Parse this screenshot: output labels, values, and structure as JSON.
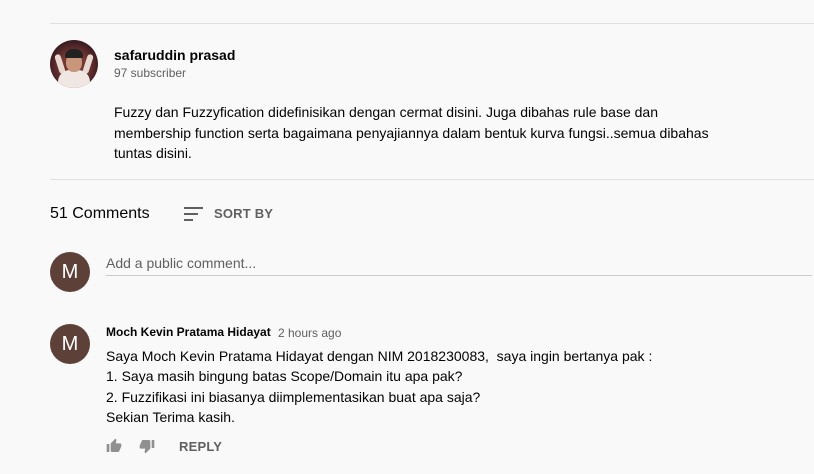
{
  "channel": {
    "name": "safaruddin prasad",
    "subscribers": "97 subscriber",
    "description_lines": [
      "Fuzzy dan Fuzzyfication didefinisikan dengan cermat disini. Juga dibahas rule base dan",
      "membership function serta bagaimana penyajiannya dalam bentuk kurva fungsi..semua dibahas",
      "tuntas disini."
    ]
  },
  "comments_header": {
    "count_label": "51 Comments",
    "sort_label": "SORT BY",
    "sort_icon": "sort-icon"
  },
  "add_comment": {
    "avatar_letter": "M",
    "placeholder": "Add a public comment..."
  },
  "comments": [
    {
      "avatar_letter": "M",
      "author": "Moch Kevin Pratama Hidayat",
      "time": "2 hours ago",
      "lines": [
        "Saya Moch Kevin Pratama Hidayat dengan NIM 2018230083,  saya ingin bertanya pak :",
        "1. Saya masih bingung batas Scope/Domain itu apa pak?",
        "2. Fuzzifikasi ini biasanya diimplementasikan buat apa saja?",
        "Sekian Terima kasih."
      ],
      "like_icon": "thumbs-up-icon",
      "dislike_icon": "thumbs-down-icon",
      "reply_label": "REPLY"
    }
  ],
  "colors": {
    "background": "#f9f9f9",
    "avatar": "#5d4037",
    "secondary_text": "#606060",
    "divider": "#e0e0e0"
  }
}
